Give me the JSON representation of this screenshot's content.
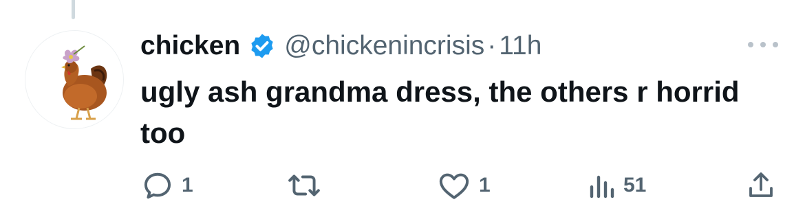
{
  "tweet": {
    "display_name": "chicken",
    "handle": "@chickenincrisis",
    "separator": "·",
    "time": "11h",
    "verified_icon": "verified-badge-icon",
    "verified_color": "#1d9bf0",
    "avatar_icon": "chicken-avatar",
    "text": "ugly ash grandma dress, the others r horrid too"
  },
  "actions": {
    "reply": {
      "icon": "reply-icon",
      "count": "1"
    },
    "retweet": {
      "icon": "retweet-icon",
      "count": ""
    },
    "like": {
      "icon": "heart-icon",
      "count": "1"
    },
    "views": {
      "icon": "views-icon",
      "count": "51"
    },
    "share": {
      "icon": "share-icon"
    }
  },
  "colors": {
    "text_primary": "#0f1419",
    "text_secondary": "#536471",
    "background": "#ffffff"
  }
}
